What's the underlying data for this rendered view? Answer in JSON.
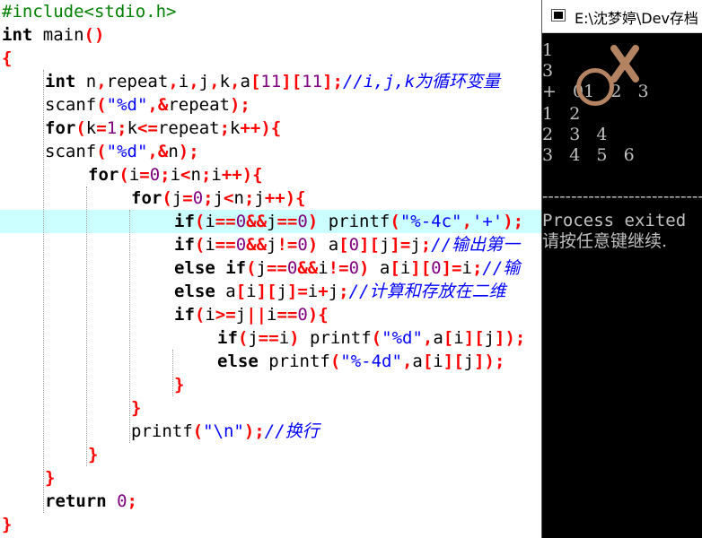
{
  "editor": {
    "lines": [
      {
        "indent": 0,
        "tokens": [
          [
            "pp",
            "#include<stdio.h>"
          ]
        ]
      },
      {
        "indent": 0,
        "tokens": [
          [
            "kw",
            "int"
          ],
          [
            "id",
            " main"
          ],
          [
            "op",
            "()"
          ]
        ]
      },
      {
        "indent": 0,
        "tokens": [
          [
            "op",
            "{"
          ]
        ]
      },
      {
        "indent": 1,
        "tokens": [
          [
            "kw",
            "int"
          ],
          [
            "id",
            " n"
          ],
          [
            "op",
            ","
          ],
          [
            "id",
            "repeat"
          ],
          [
            "op",
            ","
          ],
          [
            "id",
            "i"
          ],
          [
            "op",
            ","
          ],
          [
            "id",
            "j"
          ],
          [
            "op",
            ","
          ],
          [
            "id",
            "k"
          ],
          [
            "op",
            ","
          ],
          [
            "id",
            "a"
          ],
          [
            "op",
            "["
          ],
          [
            "num",
            "11"
          ],
          [
            "op",
            "]["
          ],
          [
            "num",
            "11"
          ],
          [
            "op",
            "];"
          ],
          [
            "cm",
            "//i,j,k为循环变量"
          ]
        ]
      },
      {
        "indent": 1,
        "tokens": [
          [
            "id",
            "scanf"
          ],
          [
            "op",
            "("
          ],
          [
            "str",
            "\"%d\""
          ],
          [
            "op",
            ",&"
          ],
          [
            "id",
            "repeat"
          ],
          [
            "op",
            ");"
          ]
        ]
      },
      {
        "indent": 1,
        "tokens": [
          [
            "kw",
            "for"
          ],
          [
            "op",
            "("
          ],
          [
            "id",
            "k"
          ],
          [
            "op",
            "="
          ],
          [
            "num",
            "1"
          ],
          [
            "op",
            ";"
          ],
          [
            "id",
            "k"
          ],
          [
            "op",
            "<="
          ],
          [
            "id",
            "repeat"
          ],
          [
            "op",
            ";"
          ],
          [
            "id",
            "k"
          ],
          [
            "op",
            "++){"
          ]
        ]
      },
      {
        "indent": 1,
        "tokens": [
          [
            "id",
            "scanf"
          ],
          [
            "op",
            "("
          ],
          [
            "str",
            "\"%d\""
          ],
          [
            "op",
            ",&"
          ],
          [
            "id",
            "n"
          ],
          [
            "op",
            ");"
          ]
        ]
      },
      {
        "indent": 2,
        "tokens": [
          [
            "kw",
            "for"
          ],
          [
            "op",
            "("
          ],
          [
            "id",
            "i"
          ],
          [
            "op",
            "="
          ],
          [
            "num",
            "0"
          ],
          [
            "op",
            ";"
          ],
          [
            "id",
            "i"
          ],
          [
            "op",
            "<"
          ],
          [
            "id",
            "n"
          ],
          [
            "op",
            ";"
          ],
          [
            "id",
            "i"
          ],
          [
            "op",
            "++){"
          ]
        ]
      },
      {
        "indent": 3,
        "tokens": [
          [
            "kw",
            "for"
          ],
          [
            "op",
            "("
          ],
          [
            "id",
            "j"
          ],
          [
            "op",
            "="
          ],
          [
            "num",
            "0"
          ],
          [
            "op",
            ";"
          ],
          [
            "id",
            "j"
          ],
          [
            "op",
            "<"
          ],
          [
            "id",
            "n"
          ],
          [
            "op",
            ";"
          ],
          [
            "id",
            "j"
          ],
          [
            "op",
            "++){"
          ]
        ]
      },
      {
        "indent": 4,
        "active": true,
        "tokens": [
          [
            "kw",
            "if"
          ],
          [
            "op",
            "("
          ],
          [
            "id",
            "i"
          ],
          [
            "op",
            "=="
          ],
          [
            "num",
            "0"
          ],
          [
            "op",
            "&&"
          ],
          [
            "id",
            "j"
          ],
          [
            "op",
            "=="
          ],
          [
            "num",
            "0"
          ],
          [
            "op",
            ")"
          ],
          [
            "id",
            " printf"
          ],
          [
            "op",
            "("
          ],
          [
            "str",
            "\"%-4c\""
          ],
          [
            "op",
            ","
          ],
          [
            "str",
            "'+'"
          ],
          [
            "op",
            ");"
          ]
        ]
      },
      {
        "indent": 4,
        "tokens": [
          [
            "kw",
            "if"
          ],
          [
            "op",
            "("
          ],
          [
            "id",
            "i"
          ],
          [
            "op",
            "=="
          ],
          [
            "num",
            "0"
          ],
          [
            "op",
            "&&"
          ],
          [
            "id",
            "j"
          ],
          [
            "op",
            "!="
          ],
          [
            "num",
            "0"
          ],
          [
            "op",
            ")"
          ],
          [
            "id",
            " a"
          ],
          [
            "op",
            "["
          ],
          [
            "num",
            "0"
          ],
          [
            "op",
            "]["
          ],
          [
            "id",
            "j"
          ],
          [
            "op",
            "]="
          ],
          [
            "id",
            "j"
          ],
          [
            "op",
            ";"
          ],
          [
            "cm",
            "//输出第一"
          ]
        ]
      },
      {
        "indent": 4,
        "tokens": [
          [
            "kw",
            "else if"
          ],
          [
            "op",
            "("
          ],
          [
            "id",
            "j"
          ],
          [
            "op",
            "=="
          ],
          [
            "num",
            "0"
          ],
          [
            "op",
            "&&"
          ],
          [
            "id",
            "i"
          ],
          [
            "op",
            "!="
          ],
          [
            "num",
            "0"
          ],
          [
            "op",
            ")"
          ],
          [
            "id",
            " a"
          ],
          [
            "op",
            "["
          ],
          [
            "id",
            "i"
          ],
          [
            "op",
            "]["
          ],
          [
            "num",
            "0"
          ],
          [
            "op",
            "]="
          ],
          [
            "id",
            "i"
          ],
          [
            "op",
            ";"
          ],
          [
            "cm",
            "//输"
          ]
        ]
      },
      {
        "indent": 4,
        "tokens": [
          [
            "kw",
            "else"
          ],
          [
            "id",
            " a"
          ],
          [
            "op",
            "["
          ],
          [
            "id",
            "i"
          ],
          [
            "op",
            "]["
          ],
          [
            "id",
            "j"
          ],
          [
            "op",
            "]="
          ],
          [
            "id",
            "i"
          ],
          [
            "op",
            "+"
          ],
          [
            "id",
            "j"
          ],
          [
            "op",
            ";"
          ],
          [
            "cm",
            "//计算和存放在二维"
          ]
        ]
      },
      {
        "indent": 4,
        "tokens": [
          [
            "kw",
            "if"
          ],
          [
            "op",
            "("
          ],
          [
            "id",
            "i"
          ],
          [
            "op",
            ">="
          ],
          [
            "id",
            "j"
          ],
          [
            "op",
            "||"
          ],
          [
            "id",
            "i"
          ],
          [
            "op",
            "=="
          ],
          [
            "num",
            "0"
          ],
          [
            "op",
            "){"
          ]
        ]
      },
      {
        "indent": 5,
        "tokens": [
          [
            "kw",
            "if"
          ],
          [
            "op",
            "("
          ],
          [
            "id",
            "j"
          ],
          [
            "op",
            "=="
          ],
          [
            "id",
            "i"
          ],
          [
            "op",
            ")"
          ],
          [
            "id",
            " printf"
          ],
          [
            "op",
            "("
          ],
          [
            "str",
            "\"%d\""
          ],
          [
            "op",
            ","
          ],
          [
            "id",
            "a"
          ],
          [
            "op",
            "["
          ],
          [
            "id",
            "i"
          ],
          [
            "op",
            "]["
          ],
          [
            "id",
            "j"
          ],
          [
            "op",
            "]);"
          ]
        ]
      },
      {
        "indent": 5,
        "tokens": [
          [
            "kw",
            "else"
          ],
          [
            "id",
            " printf"
          ],
          [
            "op",
            "("
          ],
          [
            "str",
            "\"%-4d\""
          ],
          [
            "op",
            ","
          ],
          [
            "id",
            "a"
          ],
          [
            "op",
            "["
          ],
          [
            "id",
            "i"
          ],
          [
            "op",
            "]["
          ],
          [
            "id",
            "j"
          ],
          [
            "op",
            "]);"
          ]
        ]
      },
      {
        "indent": 4,
        "tokens": [
          [
            "op",
            "}"
          ]
        ]
      },
      {
        "indent": 3,
        "tokens": [
          [
            "op",
            "}"
          ]
        ]
      },
      {
        "indent": 3,
        "tokens": [
          [
            "id",
            "printf"
          ],
          [
            "op",
            "("
          ],
          [
            "str",
            "\"\\n\""
          ],
          [
            "op",
            ");"
          ],
          [
            "cm",
            "//换行"
          ]
        ]
      },
      {
        "indent": 2,
        "tokens": [
          [
            "op",
            "}"
          ]
        ]
      },
      {
        "indent": 1,
        "tokens": [
          [
            "op",
            "}"
          ]
        ]
      },
      {
        "indent": 1,
        "tokens": [
          [
            "kw",
            "return"
          ],
          [
            "id",
            " "
          ],
          [
            "num",
            "0"
          ],
          [
            "op",
            ";"
          ]
        ]
      },
      {
        "indent": 0,
        "tokens": [
          [
            "op",
            "}"
          ]
        ]
      }
    ]
  },
  "console": {
    "title": "E:\\沈梦婷\\Dev存档",
    "lines": [
      {
        "text": "1"
      },
      {
        "text": "3"
      },
      {
        "text": "+   01   2   3"
      },
      {
        "text": "1   2"
      },
      {
        "text": "2   3   4"
      },
      {
        "text": "3   4   5   6"
      },
      {
        "text": ""
      },
      {
        "text": "--------------------------------"
      },
      {
        "text": "Process exited"
      },
      {
        "text": "请按任意键继续."
      }
    ],
    "annotation_color": "#b48462"
  }
}
